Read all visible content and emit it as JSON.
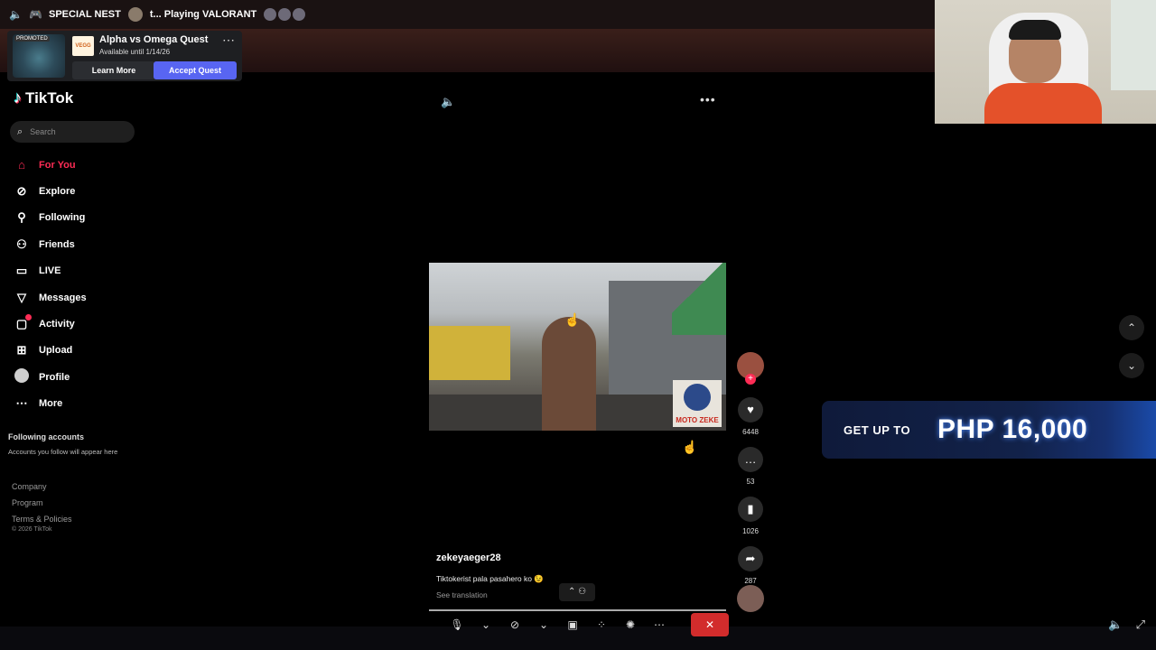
{
  "topbar": {
    "server_name": "SPECIAL NEST",
    "activity": "t... Playing VALORANT"
  },
  "promo": {
    "thumb_label": "PROMOTED",
    "brand": "VEGG",
    "title": "Alpha vs Omega Quest",
    "subtitle": "Available until 1/14/26",
    "learn_label": "Learn More",
    "accept_label": "Accept Quest"
  },
  "tiktok": {
    "logo": "TikTok",
    "search_placeholder": "Search",
    "nav": [
      {
        "label": "For You",
        "icon": "home-icon"
      },
      {
        "label": "Explore",
        "icon": "compass-icon"
      },
      {
        "label": "Following",
        "icon": "user-follow-icon"
      },
      {
        "label": "Friends",
        "icon": "friends-icon"
      },
      {
        "label": "LIVE",
        "icon": "live-icon"
      },
      {
        "label": "Messages",
        "icon": "messages-icon"
      },
      {
        "label": "Activity",
        "icon": "activity-icon"
      },
      {
        "label": "Upload",
        "icon": "upload-icon"
      },
      {
        "label": "Profile",
        "icon": "profile-avatar"
      },
      {
        "label": "More",
        "icon": "more-icon"
      }
    ],
    "following_heading": "Following accounts",
    "following_sub": "Accounts you follow will appear here",
    "footer": [
      "Company",
      "Program",
      "Terms & Policies"
    ],
    "copyright": "© 2026 TikTok"
  },
  "video": {
    "overlay_badge": "MOTO ZEKE",
    "username": "zekeyaeger28",
    "caption": "Tiktokerist pala pasahero ko 😉",
    "see_translation": "See translation",
    "progress": 1.0
  },
  "actions": {
    "likes": "6448",
    "comments": "53",
    "saves": "1026",
    "shares": "287"
  },
  "ad": {
    "prefix": "GET UP TO",
    "amount": "PHP 16,000"
  },
  "colors": {
    "tiktok_red": "#fe2c55",
    "discord_blurple": "#5865f2",
    "end_call": "#d22c2c"
  }
}
